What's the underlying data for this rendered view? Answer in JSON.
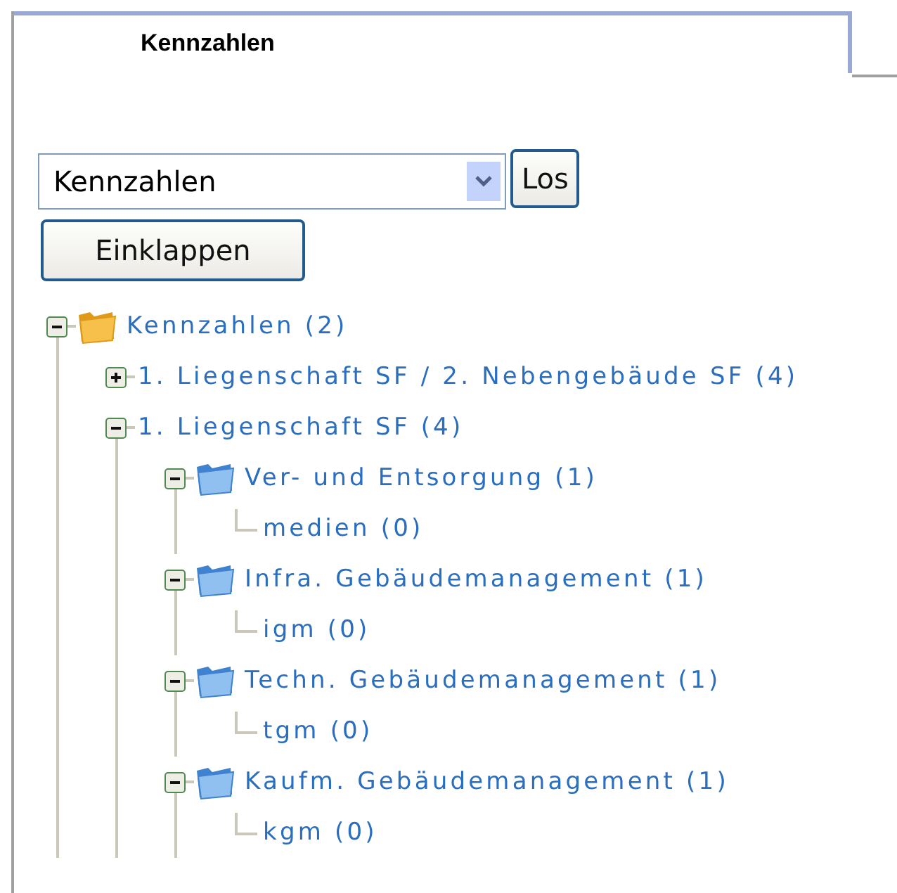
{
  "tab": {
    "title": "Kennzahlen"
  },
  "dropdown": {
    "value": "Kennzahlen"
  },
  "go_button": "Los",
  "collapse_button": "Einklappen",
  "tree": [
    {
      "label": "Kennzahlen (2)",
      "kind": "root-folder",
      "expanded": true,
      "children": [
        {
          "label": "1. Liegenschaft SF / 2. Nebengebäude SF (4)",
          "kind": "group",
          "expanded": false
        },
        {
          "label": "1. Liegenschaft SF (4)",
          "kind": "group",
          "expanded": true,
          "children": [
            {
              "label": "Ver- und Entsorgung (1)",
              "kind": "folder",
              "expanded": true,
              "children": [
                {
                  "label": "medien (0)",
                  "kind": "leaf"
                }
              ]
            },
            {
              "label": "Infra. Gebäudemanagement (1)",
              "kind": "folder",
              "expanded": true,
              "children": [
                {
                  "label": "igm (0)",
                  "kind": "leaf"
                }
              ]
            },
            {
              "label": "Techn. Gebäudemanagement (1)",
              "kind": "folder",
              "expanded": true,
              "children": [
                {
                  "label": "tgm (0)",
                  "kind": "leaf"
                }
              ]
            },
            {
              "label": "Kaufm. Gebäudemanagement (1)",
              "kind": "folder",
              "expanded": true,
              "children": [
                {
                  "label": "kgm (0)",
                  "kind": "leaf"
                }
              ]
            }
          ]
        }
      ]
    }
  ]
}
